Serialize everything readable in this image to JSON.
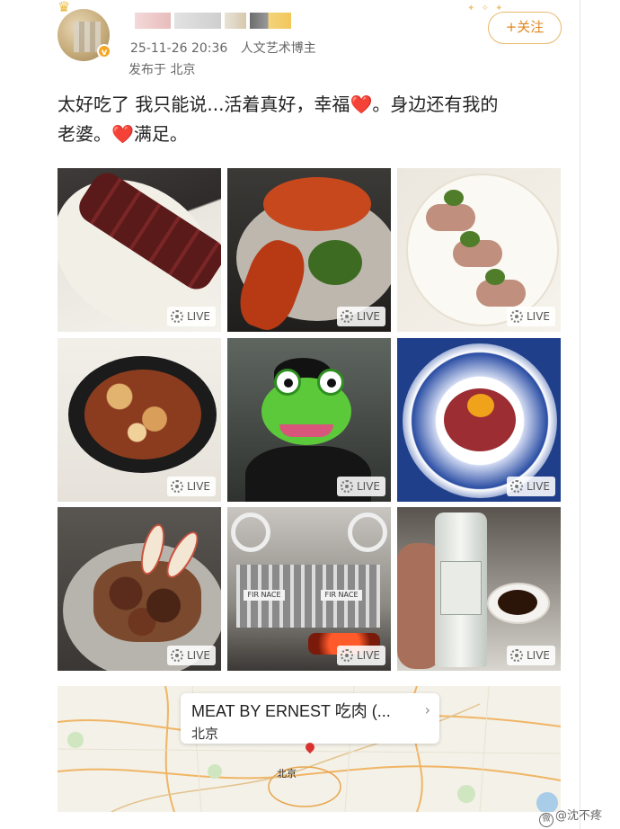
{
  "header": {
    "timestamp": "25-11-26 20:36",
    "account_tag": "人文艺术博主",
    "location_line": "发布于 北京",
    "follow_label": "+关注"
  },
  "post": {
    "text_line1_a": "太好吃了 我只能说...活着真好，幸福",
    "text_line1_b": "。身边还有我的",
    "text_line2_a": "老婆。",
    "text_line2_b": "满足。",
    "heart": "❤️"
  },
  "photos": [
    {
      "badge": "LIVE",
      "subject": "steak"
    },
    {
      "badge": "LIVE",
      "subject": "lobster"
    },
    {
      "badge": "LIVE",
      "subject": "appetizer"
    },
    {
      "badge": "LIVE",
      "subject": "skillet"
    },
    {
      "badge": "LIVE",
      "subject": "frog-face"
    },
    {
      "badge": "LIVE",
      "subject": "tartare"
    },
    {
      "badge": "LIVE",
      "subject": "meat-with-apple"
    },
    {
      "badge": "LIVE",
      "subject": "grill"
    },
    {
      "badge": "LIVE",
      "subject": "bottle"
    }
  ],
  "grill_sign": "FIR NACE",
  "map": {
    "place_title": "MEAT BY ERNEST 吃肉 (...",
    "place_city": "北京",
    "city_label": "北京"
  },
  "watermark": {
    "logo": "微",
    "text": "@沈不疼"
  },
  "colors": {
    "follow_border": "#e8b86b",
    "follow_text": "#e0871f",
    "heart": "#e8303a",
    "pin": "#d8322e"
  },
  "icons": {
    "avatar_badge": "v-badge-icon",
    "live_badge": "live-ring-icon",
    "map_card": "chevron-right-icon",
    "map_marker": "map-pin-icon"
  }
}
